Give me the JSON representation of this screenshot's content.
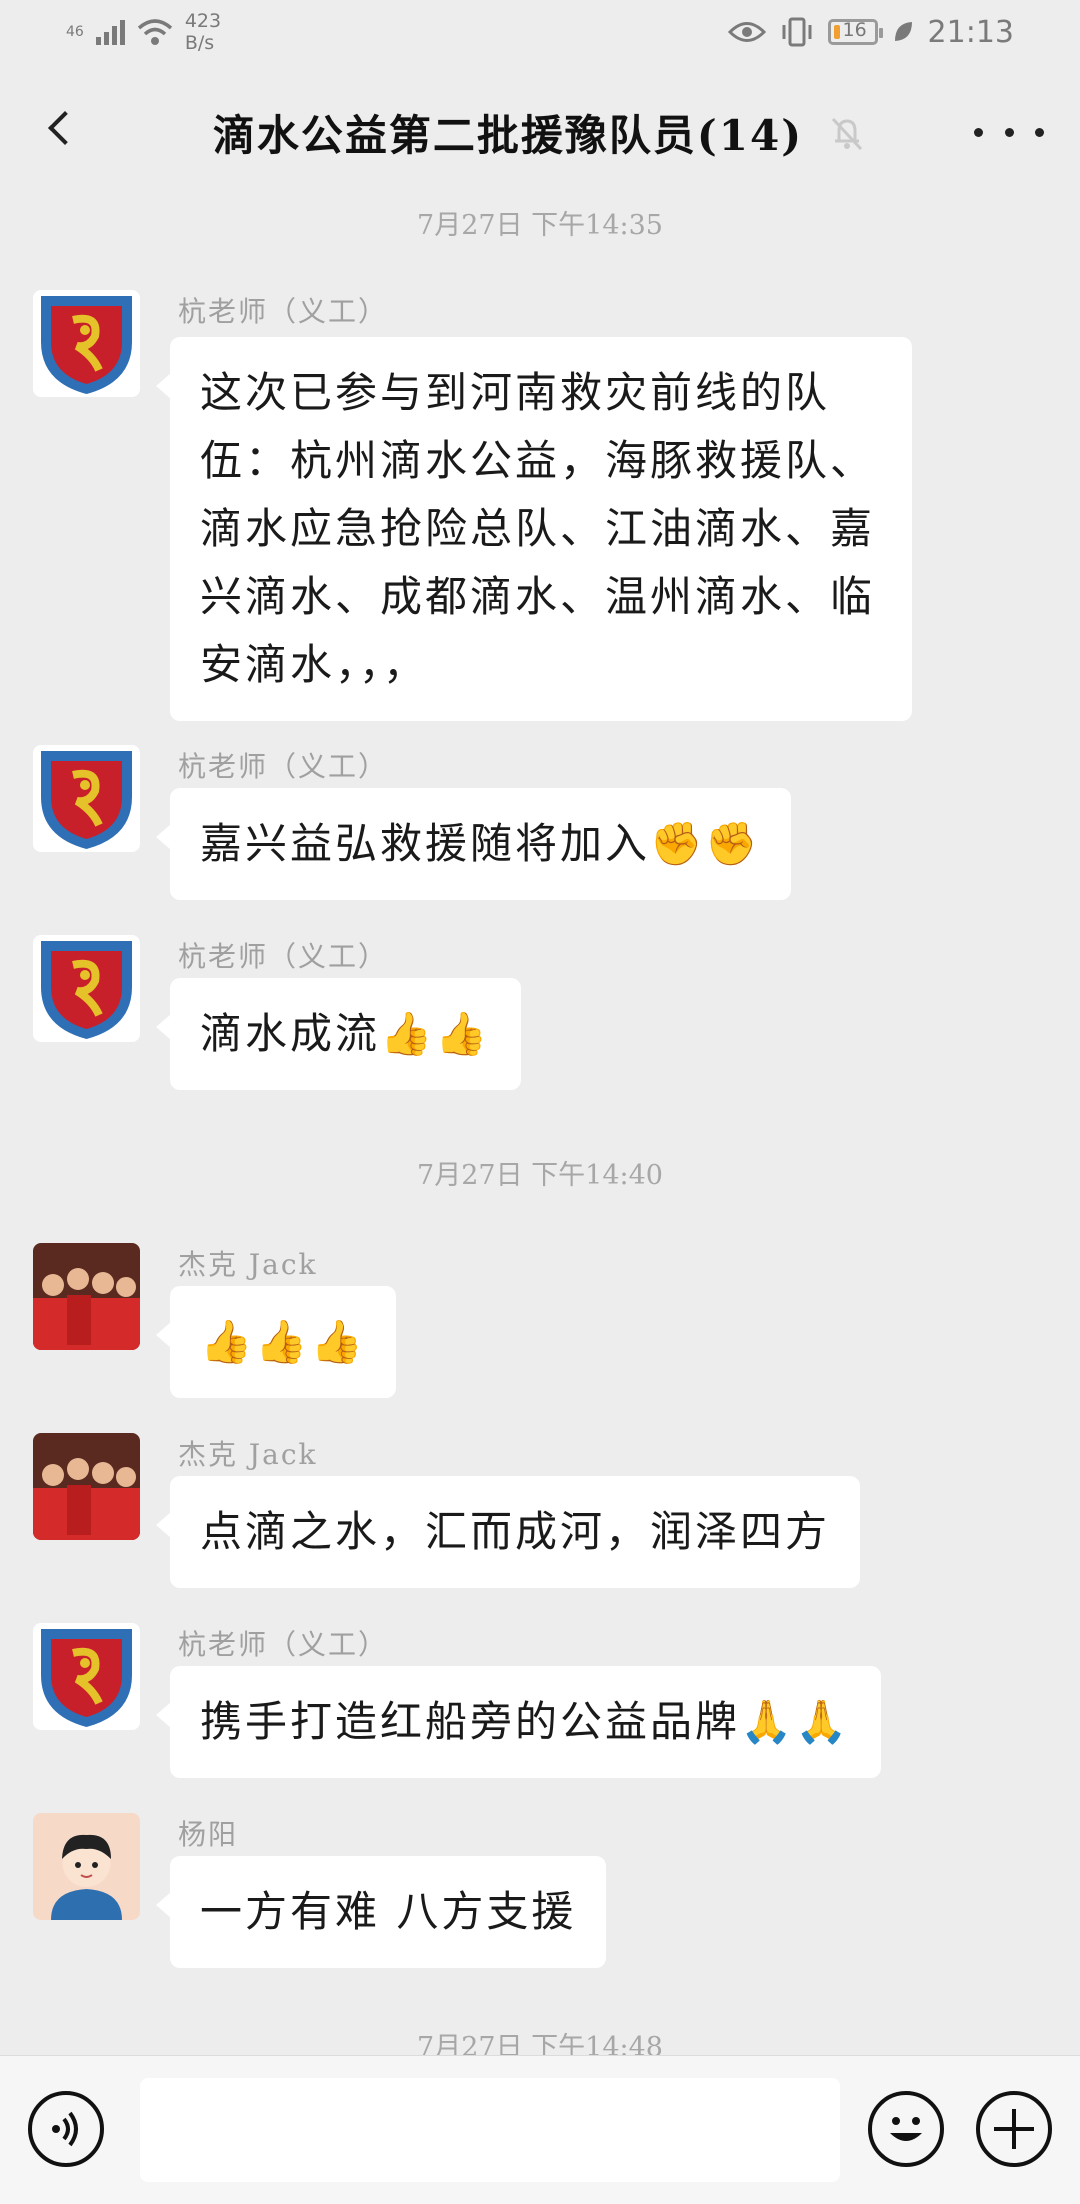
{
  "status_bar": {
    "network_type": "46",
    "speed_value": "423",
    "speed_unit": "B/s",
    "battery_level": "16",
    "battery_fraction": 0.16,
    "time": "21:13"
  },
  "header": {
    "title": "滴水公益第二批援豫队员(14)"
  },
  "timestamps": [
    "7月27日 下午14:35",
    "7月27日 下午14:40",
    "7月27日 下午14:48"
  ],
  "messages": [
    {
      "sender": "杭老师（义工）",
      "avatar": "shield-dragon-logo",
      "text": "这次已参与到河南救灾前线的队伍：杭州滴水公益，海豚救援队、滴水应急抢险总队、江油滴水、嘉兴滴水、成都滴水、温州滴水、临安滴水，，，"
    },
    {
      "sender": "杭老师（义工）",
      "avatar": "shield-dragon-logo",
      "text": "嘉兴益弘救援随将加入✊✊"
    },
    {
      "sender": "杭老师（义工）",
      "avatar": "shield-dragon-logo",
      "text": "滴水成流👍👍"
    },
    {
      "sender": "杰克 Jack",
      "avatar": "group-photo",
      "text": "👍👍👍"
    },
    {
      "sender": "杰克 Jack",
      "avatar": "group-photo",
      "text": "点滴之水，汇而成河，润泽四方"
    },
    {
      "sender": "杭老师（义工）",
      "avatar": "shield-dragon-logo",
      "text": "携手打造红船旁的公益品牌🙏🙏"
    },
    {
      "sender": "杨阳",
      "avatar": "cartoon-boy",
      "text": "一方有难 八方支援"
    }
  ],
  "input_bar": {
    "placeholder": ""
  },
  "colors": {
    "background": "#ededed",
    "bubble": "#ffffff",
    "shield_blue": "#2f6fb5",
    "shield_red": "#c8202a",
    "logo_gold": "#e6c22a"
  }
}
